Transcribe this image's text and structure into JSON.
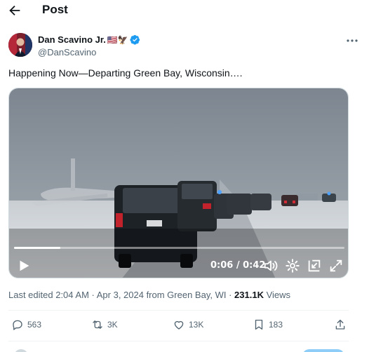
{
  "header": {
    "title": "Post"
  },
  "author": {
    "display_name": "Dan Scavino Jr.",
    "emojis": "🇺🇸🦅",
    "handle": "@DanScavino"
  },
  "tweet": {
    "text": "Happening Now—Departing Green Bay, Wisconsin…."
  },
  "video": {
    "time": "0:06 / 0:42",
    "progress": 0.14
  },
  "meta": {
    "edited": "Last edited 2:04 AM · Apr 3, 2024 from Green Bay, WI · ",
    "views_count": "231.1K",
    "views_label": " Views"
  },
  "actions": {
    "replies": "563",
    "reposts": "3K",
    "likes": "13K",
    "bookmarks": "183"
  },
  "colors": {
    "verified": "#1d9bf0",
    "text_secondary": "#536471"
  }
}
